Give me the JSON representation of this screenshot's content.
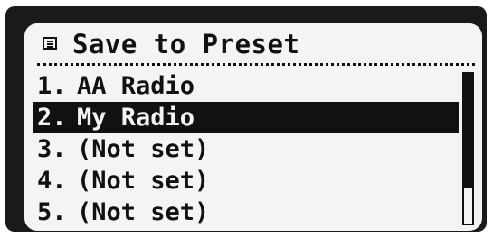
{
  "header": {
    "icon": "list-icon",
    "title": "Save to Preset"
  },
  "presets": [
    {
      "number": "1.",
      "name": "AA Radio",
      "selected": false
    },
    {
      "number": "2.",
      "name": "My Radio",
      "selected": true
    },
    {
      "number": "3.",
      "name": "(Not set)",
      "selected": false
    },
    {
      "number": "4.",
      "name": "(Not set)",
      "selected": false
    },
    {
      "number": "5.",
      "name": "(Not set)",
      "selected": false
    }
  ],
  "scrollbar": {
    "visible_fraction": 0.76,
    "position_fraction": 0.0
  }
}
